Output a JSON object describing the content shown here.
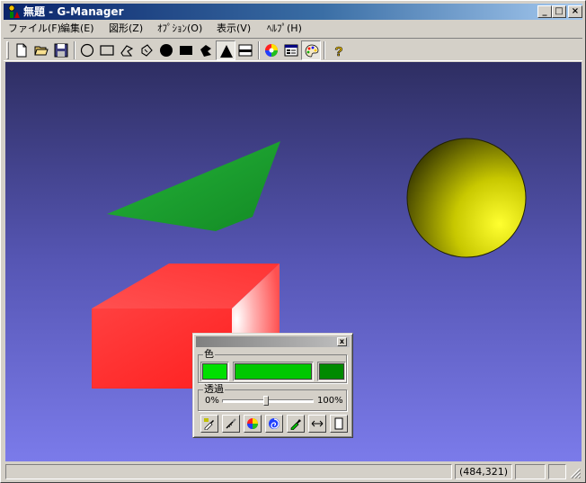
{
  "window": {
    "title": "無題 - G-Manager"
  },
  "menu": [
    {
      "label": "ファイル(F)"
    },
    {
      "label": "編集(E)"
    },
    {
      "label": "図形(Z)"
    },
    {
      "label": "ｵﾌﾟｼｮﾝ(O)"
    },
    {
      "label": "表示(V)"
    },
    {
      "label": "ﾍﾙﾌﾟ(H)"
    }
  ],
  "toolbar": {
    "tools": [
      "new-file-icon",
      "open-folder-icon",
      "save-disk-icon",
      "ellipse-icon",
      "rectangle-icon",
      "polygon-icon",
      "rotated-shape-icon",
      "filled-circle-icon",
      "filled-rectangle-icon",
      "filled-polygon-icon",
      "filled-triangle-icon",
      "frame-icon",
      "color-wheel-icon",
      "properties-dialog-icon",
      "palette-icon",
      "help-icon"
    ],
    "pressed": [
      "filled-triangle-icon",
      "palette-icon"
    ],
    "help_label": "?"
  },
  "scene": {
    "triangle_color": "#1f9e2e",
    "sphere_color": "#e8e800",
    "box_color": "#ff3030"
  },
  "color_panel": {
    "color_label": "色",
    "transparency_label": "透過",
    "min_label": "0%",
    "max_label": "100%",
    "transparency_value": 0.48,
    "swatches": [
      "#00e000",
      "#00c800",
      "#008a00"
    ],
    "close_label": "x"
  },
  "status": {
    "coords": "(484,321)"
  }
}
